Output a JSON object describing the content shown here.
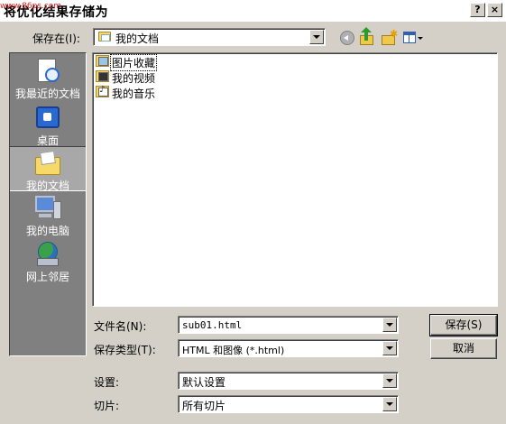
{
  "window": {
    "title": "将优化结果存储为",
    "watermark": "www.86ps.com",
    "help_label": "?",
    "close_label": "×"
  },
  "save_in": {
    "label": "保存在(I):",
    "value": "我的文档"
  },
  "toolbar": {
    "icons": [
      "back-icon",
      "up-folder-icon",
      "new-folder-icon",
      "views-menu-icon"
    ]
  },
  "places": [
    {
      "label": "我最近的文档",
      "icon": "recent-documents-icon"
    },
    {
      "label": "桌面",
      "icon": "desktop-icon"
    },
    {
      "label": "我的文档",
      "icon": "my-documents-icon",
      "selected": true
    },
    {
      "label": "我的电脑",
      "icon": "my-computer-icon"
    },
    {
      "label": "网上邻居",
      "icon": "network-places-icon"
    }
  ],
  "files": [
    {
      "name": "图片收藏",
      "icon": "pictures-folder-icon"
    },
    {
      "name": "我的视频",
      "icon": "videos-folder-icon"
    },
    {
      "name": "我的音乐",
      "icon": "music-folder-icon"
    }
  ],
  "form": {
    "filename_label": "文件名(N):",
    "filename_value": "sub01.html",
    "filetype_label": "保存类型(T):",
    "filetype_value": "HTML 和图像 (*.html)",
    "settings_label": "设置:",
    "settings_value": "默认设置",
    "slices_label": "切片:",
    "slices_value": "所有切片"
  },
  "buttons": {
    "save_label": "保存(S)",
    "cancel_label": "取消"
  }
}
